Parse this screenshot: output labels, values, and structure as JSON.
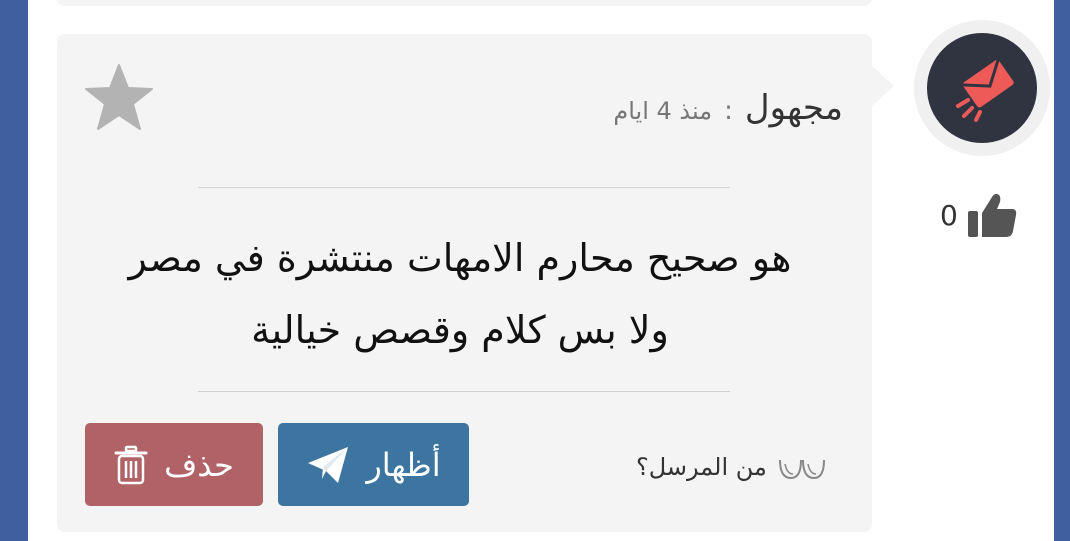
{
  "post": {
    "author": "مجهول",
    "separator": ":",
    "time": "منذ 4 ايام",
    "message_line1": "هو صحيح محارم الامهات منتشرة في مصر",
    "message_line2": "ولا بس كلام وقصص خيالية",
    "likes": "0",
    "sender_question": "من المرسل؟"
  },
  "actions": {
    "show_label": "أظهار",
    "delete_label": "حذف"
  },
  "icons": {
    "avatar": "envelope-icon",
    "like": "thumbs-up-icon",
    "favorite": "star-icon",
    "show": "paper-plane-icon",
    "delete": "trash-icon",
    "question": "eyes-icon"
  },
  "colors": {
    "page_background": "#3f5f9f",
    "card": "#f4f4f4",
    "avatar_bg": "#2f3440",
    "avatar_envelope": "#ee5a57",
    "show_button": "#3c76a0",
    "delete_button": "#b06266",
    "star": "#b3b3b3"
  }
}
